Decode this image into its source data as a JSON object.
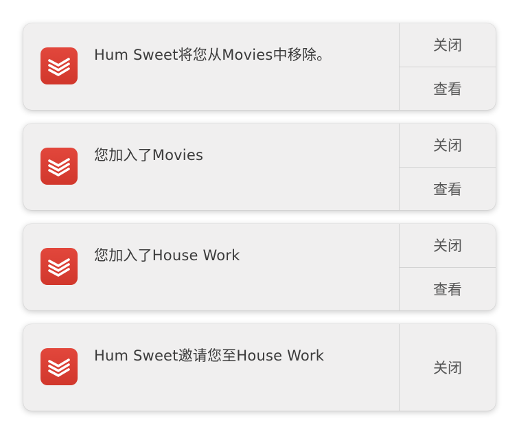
{
  "notifications": [
    {
      "app_icon": "todoist-app-icon",
      "message": "Hum Sweet将您从Movies中移除。",
      "actions": [
        "关闭",
        "查看"
      ]
    },
    {
      "app_icon": "todoist-app-icon",
      "message": "您加入了Movies",
      "actions": [
        "关闭",
        "查看"
      ]
    },
    {
      "app_icon": "todoist-app-icon",
      "message": "您加入了House Work",
      "actions": [
        "关闭",
        "查看"
      ]
    },
    {
      "app_icon": "todoist-app-icon",
      "message": "Hum Sweet邀请您至House Work",
      "actions": [
        "关闭"
      ]
    }
  ],
  "colors": {
    "icon_red": "#dc3f33",
    "card_bg": "#f0efef",
    "text": "#3b3b3b"
  }
}
